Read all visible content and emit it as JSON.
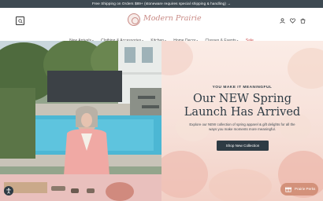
{
  "announcement": "Free Shipping on Orders $89+ (stoneware requires special shipping & handling) →",
  "brand": {
    "name": "Modern Prairie",
    "accent": "#c98b86"
  },
  "header": {
    "icons": [
      "search-icon",
      "user-icon",
      "heart-icon",
      "cart-icon"
    ]
  },
  "nav": {
    "items": [
      {
        "label": "New Arrivals",
        "has_dropdown": true
      },
      {
        "label": "Clothing & Accessories",
        "has_dropdown": true
      },
      {
        "label": "Kitchen",
        "has_dropdown": true
      },
      {
        "label": "Home Decor",
        "has_dropdown": true
      },
      {
        "label": "Classes & Events",
        "has_dropdown": true
      },
      {
        "label": "Sale",
        "has_dropdown": false
      }
    ],
    "sale_color": "#c93f3f"
  },
  "hero": {
    "tagline": "YOU MAKE IT MEANINGFUL",
    "headline_line1": "Our NEW Spring",
    "headline_line2": "Launch Has Arrived",
    "subtext": "Explore our NEW collection of spring apparel & gift delights for all the ways you make moments more meaningful.",
    "cta": "Shop New Collection"
  },
  "chat": {
    "label": "Prairie Perks"
  },
  "colors": {
    "dark": "#2e3b44",
    "chat": "#d3917a",
    "hero_bg": "#f6dfd7"
  }
}
